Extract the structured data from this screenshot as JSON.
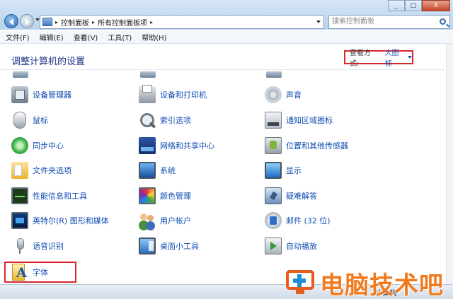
{
  "window": {
    "controls": [
      "_",
      "□",
      "X"
    ]
  },
  "nav": {
    "breadcrumbs": [
      "控制面板",
      "所有控制面板项"
    ],
    "search_placeholder": "搜索控制面板"
  },
  "menu": [
    "文件(F)",
    "编辑(E)",
    "查看(V)",
    "工具(T)",
    "帮助(H)"
  ],
  "header": {
    "title": "调整计算机的设置",
    "view_label": "查看方式:",
    "view_value": "大图标"
  },
  "items": [
    {
      "label": "设备管理器",
      "icon": "device-manager-icon"
    },
    {
      "label": "设备和打印机",
      "icon": "printer-icon"
    },
    {
      "label": "声音",
      "icon": "speaker-icon"
    },
    {
      "label": "鼠标",
      "icon": "mouse-icon"
    },
    {
      "label": "索引选项",
      "icon": "magnifier-icon"
    },
    {
      "label": "通知区域图标",
      "icon": "notification-tray-icon"
    },
    {
      "label": "同步中心",
      "icon": "sync-icon"
    },
    {
      "label": "网络和共享中心",
      "icon": "network-icon"
    },
    {
      "label": "位置和其他传感器",
      "icon": "location-sensor-icon"
    },
    {
      "label": "文件夹选项",
      "icon": "folder-icon"
    },
    {
      "label": "系统",
      "icon": "system-monitor-icon"
    },
    {
      "label": "显示",
      "icon": "display-icon"
    },
    {
      "label": "性能信息和工具",
      "icon": "performance-icon"
    },
    {
      "label": "颜色管理",
      "icon": "color-management-icon"
    },
    {
      "label": "疑难解答",
      "icon": "troubleshoot-icon"
    },
    {
      "label": "英特尔(R) 图形和媒体",
      "icon": "intel-graphics-icon"
    },
    {
      "label": "用户帐户",
      "icon": "users-icon"
    },
    {
      "label": "邮件 (32 位)",
      "icon": "mail-icon"
    },
    {
      "label": "语音识别",
      "icon": "microphone-icon"
    },
    {
      "label": "桌面小工具",
      "icon": "gadgets-icon"
    },
    {
      "label": "自动播放",
      "icon": "autoplay-icon"
    },
    {
      "label": "字体",
      "icon": "fonts-icon"
    }
  ],
  "status": {
    "label": "计算机"
  },
  "watermark": {
    "text": "电脑技术吧"
  },
  "colors": {
    "link": "#0f4cb3",
    "highlight_border": "#d9262b",
    "watermark": "#f07a1d"
  }
}
